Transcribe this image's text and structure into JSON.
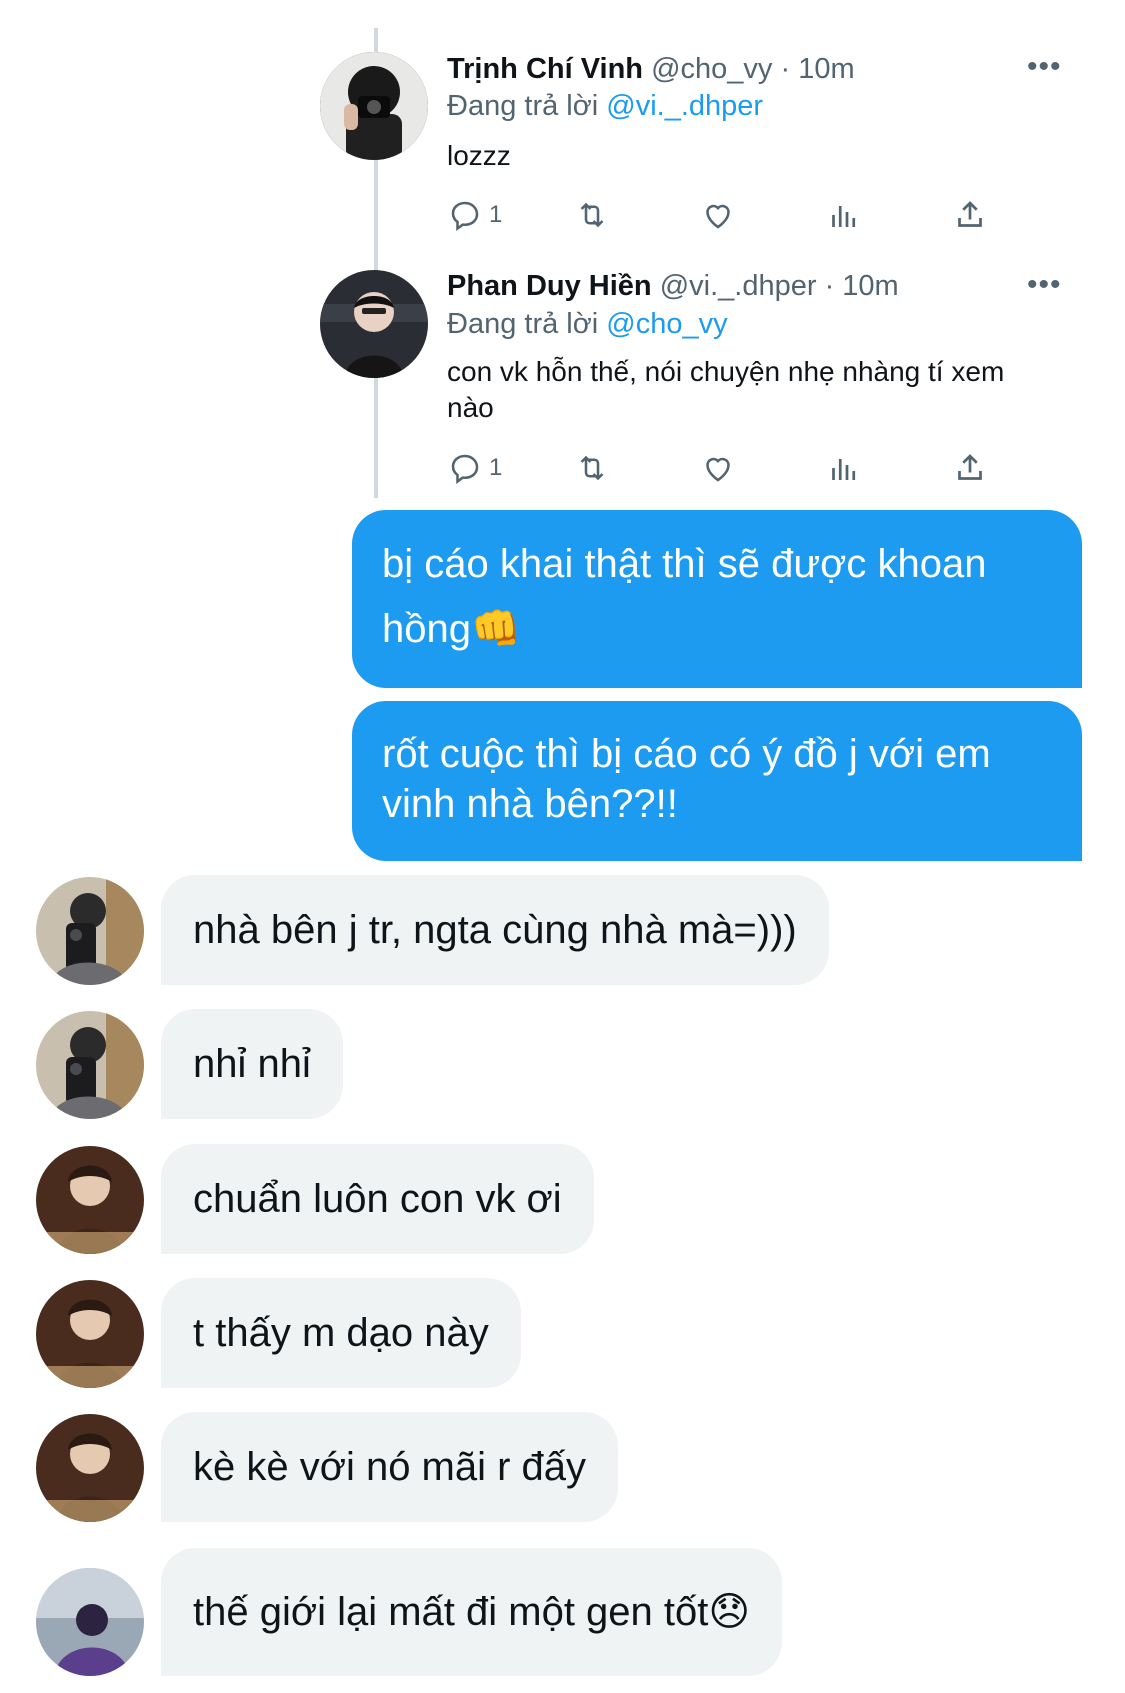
{
  "tweets": [
    {
      "name": "Trịnh Chí Vinh",
      "handle": "@cho_vy",
      "meta": "· 10m",
      "reply_prefix": "Đang trả lời",
      "reply_mention": "@vi._.dhper",
      "text": "lozzz",
      "reply_count": "1",
      "more_icon": "more-icon"
    },
    {
      "name": "Phan Duy Hiền",
      "handle": "@vi._.dhper",
      "meta": "· 10m",
      "reply_prefix": "Đang trả lời",
      "reply_mention": "@cho_vy",
      "text": "con vk hỗn thế, nói chuyện nhẹ nhàng tí xem nào",
      "reply_count": "1",
      "more_icon": "more-icon"
    }
  ],
  "messages_out": [
    {
      "text": "bị cáo khai thật thì sẽ được khoan hồng👊"
    },
    {
      "text": "rốt cuộc thì bị cáo có ý đồ j với em vinh nhà bên??!!"
    }
  ],
  "messages_in": [
    {
      "text": "nhà bên j tr, ngta cùng nhà mà=)))"
    },
    {
      "text": "nhỉ nhỉ"
    },
    {
      "text": "chuẩn luôn con vk ơi"
    },
    {
      "text": "t thấy m dạo này"
    },
    {
      "text": "kè kè với nó mãi r đấy"
    },
    {
      "text": "thế giới lại mất đi một gen tốt😞"
    }
  ],
  "colors": {
    "accent": "#1d9bf0",
    "incoming_bubble": "#eff3f4",
    "muted_text": "#536471"
  }
}
